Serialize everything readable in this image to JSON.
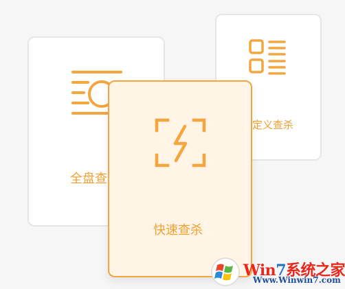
{
  "scan_options": [
    {
      "id": "full",
      "label": "全盘查杀",
      "icon": "full-scan-icon"
    },
    {
      "id": "custom",
      "label": "定义查杀",
      "icon": "list-icon"
    },
    {
      "id": "quick",
      "label": "快速查杀",
      "icon": "lightning-icon",
      "selected": true
    }
  ],
  "colors": {
    "accent": "#f4a53e",
    "label": "#f0a133",
    "selected_bg": "#fff4e5",
    "card_border": "#e6e6e6"
  },
  "watermark": {
    "title_prefix": "Win",
    "title_seven": "7",
    "title_suffix": "系统之家",
    "url": "Www.Winwin7.com"
  }
}
